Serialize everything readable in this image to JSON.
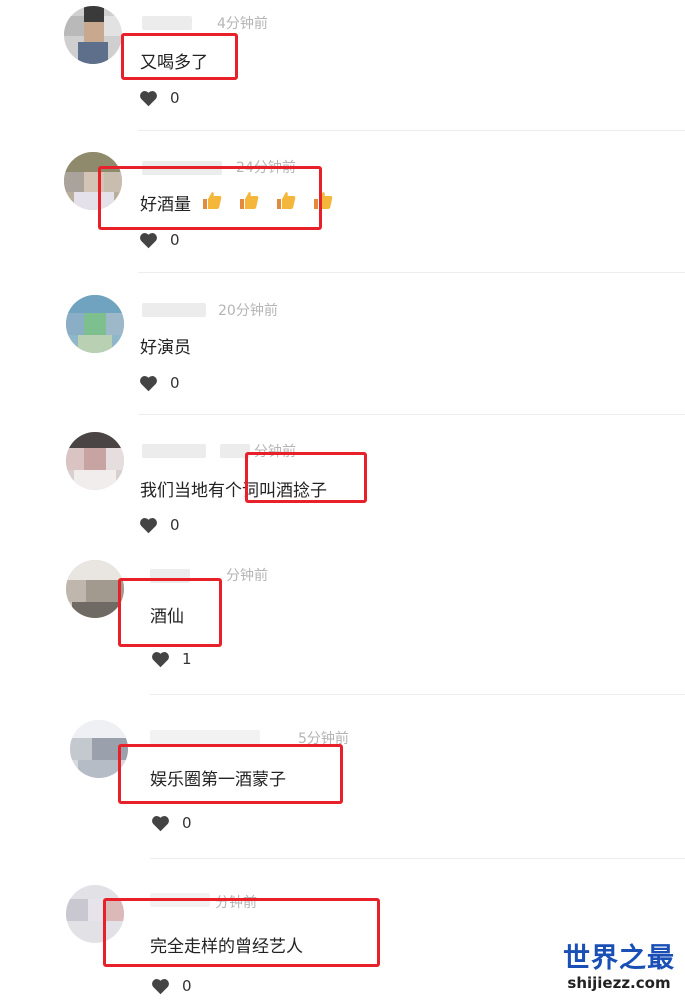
{
  "comments": [
    {
      "time": "4分钟前",
      "text": "又喝多了",
      "likes": "0"
    },
    {
      "time": "24分钟前",
      "text": "好酒量",
      "likes": "0"
    },
    {
      "time": "20分钟前",
      "text": "好演员",
      "likes": "0"
    },
    {
      "time": "分钟前",
      "text": "我们当地有个词叫酒捻子",
      "likes": "0"
    },
    {
      "time": "分钟前",
      "text": "酒仙",
      "likes": "1"
    },
    {
      "time": "5分钟前",
      "text": "娱乐圈第一酒蒙子",
      "likes": "0"
    },
    {
      "time": "分钟前",
      "text": "完全走样的曾经艺人",
      "likes": "0"
    }
  ],
  "watermark": {
    "cn": "世界之最",
    "en": "shijiezz.com"
  },
  "colors": {
    "highlight": "#e8202a",
    "watermark": "#1a4fb6"
  }
}
